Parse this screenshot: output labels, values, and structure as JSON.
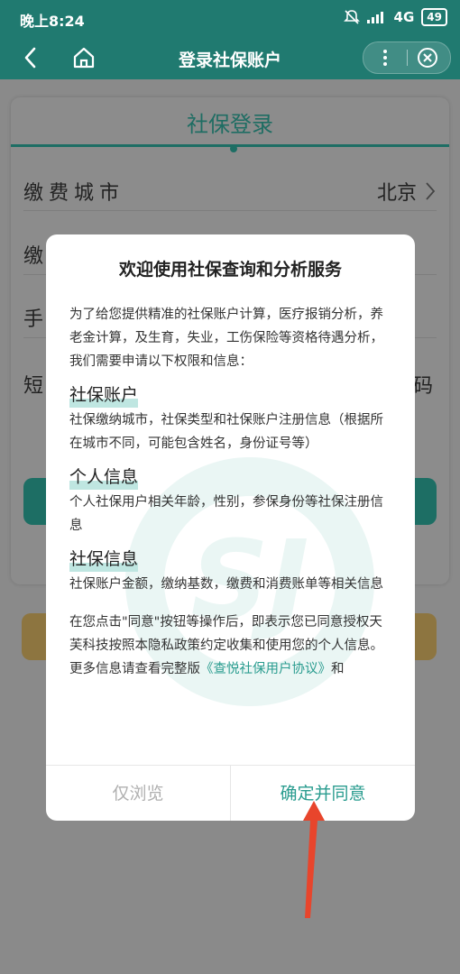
{
  "status_bar": {
    "time": "晚上8:24",
    "network": "4G",
    "battery": "49"
  },
  "nav": {
    "title": "登录社保账户"
  },
  "background": {
    "card_title": "社保登录",
    "rows": [
      {
        "label": "缴费城市",
        "value": "北京"
      },
      {
        "label": "缴",
        "value": ""
      },
      {
        "label": "手",
        "value": ""
      },
      {
        "label": "短",
        "value": "码"
      }
    ]
  },
  "modal": {
    "title": "欢迎使用社保查询和分析服务",
    "intro": "为了给您提供精准的社保账户计算，医疗报销分析，养老金计算，及生育，失业，工伤保险等资格待遇分析，我们需要申请以下权限和信息：",
    "sections": [
      {
        "title": "社保账户",
        "text": "社保缴纳城市，社保类型和社保账户注册信息（根据所在城市不同，可能包含姓名，身份证号等）"
      },
      {
        "title": "个人信息",
        "text": "个人社保用户相关年龄，性别，参保身份等社保注册信息"
      },
      {
        "title": "社保信息",
        "text": "社保账户金额，缴纳基数，缴费和消费账单等相关信息"
      }
    ],
    "consent": "在您点击\"同意\"按钮等操作后，即表示您已同意授权天芙科技按照本隐私政策约定收集和使用您的个人信息。",
    "more_prefix": "更多信息请查看完整版",
    "more_link": "《查悦社保用户协议》",
    "more_suffix": "和",
    "browse_label": "仅浏览",
    "agree_label": "确定并同意"
  },
  "colors": {
    "brand": "#2a9c8f",
    "navbar": "#207a70",
    "arrow": "#e8452c"
  }
}
